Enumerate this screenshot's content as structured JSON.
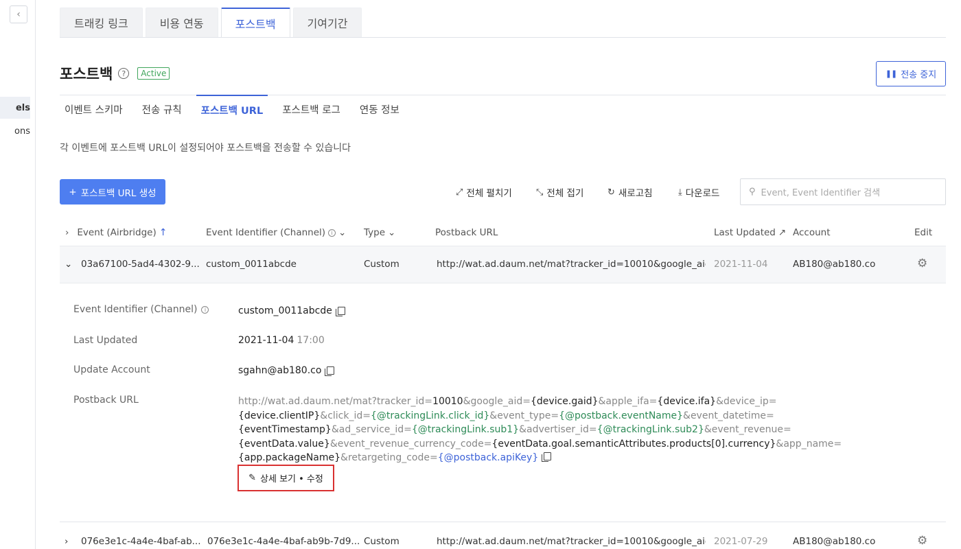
{
  "sidebar": {
    "collapse_icon": "chevron-left-icon",
    "items": [
      {
        "label": "els",
        "active": true
      },
      {
        "label": "ons",
        "active": false
      }
    ]
  },
  "top_tabs": [
    {
      "label": "트래킹 링크",
      "active": false
    },
    {
      "label": "비용 연동",
      "active": false
    },
    {
      "label": "포스트백",
      "active": true
    },
    {
      "label": "기여기간",
      "active": false
    }
  ],
  "header": {
    "title": "포스트백",
    "help_icon": "?",
    "status": "Active",
    "stop_button": "전송 중지"
  },
  "sub_tabs": [
    {
      "label": "이벤트 스키마",
      "active": false
    },
    {
      "label": "전송 규칙",
      "active": false
    },
    {
      "label": "포스트백 URL",
      "active": true
    },
    {
      "label": "포스트백 로그",
      "active": false
    },
    {
      "label": "연동 정보",
      "active": false
    }
  ],
  "description": "각 이벤트에 포스트백 URL이 설정되어야 포스트백을 전송할 수 있습니다",
  "toolbar": {
    "create_label": "포스트백 URL 생성",
    "expand_all": "전체 펼치기",
    "collapse_all": "전체 접기",
    "refresh": "새로고침",
    "download": "다운로드",
    "search_placeholder": "Event, Event Identifier 검색"
  },
  "table": {
    "headers": {
      "event": "Event (Airbridge)",
      "identifier": "Event Identifier (Channel)",
      "type": "Type",
      "postback_url": "Postback URL",
      "last_updated": "Last Updated",
      "account": "Account",
      "edit": "Edit"
    },
    "rows": [
      {
        "event": "03a67100-5ad4-4302-9...",
        "identifier": "custom_0011abcde",
        "type": "Custom",
        "url": "http://wat.ad.daum.net/mat?tracker_id=10010&google_aid=...",
        "updated": "2021-11-04",
        "account": "AB180@ab180.co",
        "expanded": true
      },
      {
        "event": "076e3e1c-4a4e-4baf-ab...",
        "identifier": "076e3e1c-4a4e-4baf-ab9b-7d9...",
        "type": "Custom",
        "url": "http://wat.ad.daum.net/mat?tracker_id=10010&google_aid=...",
        "updated": "2021-07-29",
        "account": "AB180@ab180.co",
        "expanded": false
      }
    ]
  },
  "detail": {
    "identifier_label": "Event Identifier (Channel)",
    "identifier_value": "custom_0011abcde",
    "updated_label": "Last Updated",
    "updated_date": "2021-11-04",
    "updated_time": "17:00",
    "account_label": "Update Account",
    "account_value": "sgahn@ab180.co",
    "url_label": "Postback URL",
    "url_parts": [
      {
        "t": "http://wat.ad.daum.net/mat?tracker_id=",
        "c": "m"
      },
      {
        "t": "10010",
        "c": "v"
      },
      {
        "t": "&google_aid=",
        "c": "m"
      },
      {
        "t": "{device.gaid}",
        "c": "v"
      },
      {
        "t": "&apple_ifa=",
        "c": "m"
      },
      {
        "t": "{device.ifa}",
        "c": "v"
      },
      {
        "t": "&device_ip=",
        "c": "m"
      },
      {
        "t": "{device.clientIP}",
        "c": "v"
      },
      {
        "t": "&click_id=",
        "c": "m"
      },
      {
        "t": "{@trackingLink.click_id}",
        "c": "g"
      },
      {
        "t": "&event_type=",
        "c": "m"
      },
      {
        "t": "{@postback.eventName}",
        "c": "g"
      },
      {
        "t": "&event_datetime=",
        "c": "m"
      },
      {
        "t": "{eventTimestamp}",
        "c": "v"
      },
      {
        "t": "&ad_service_id=",
        "c": "m"
      },
      {
        "t": "{@trackingLink.sub1}",
        "c": "g"
      },
      {
        "t": "&advertiser_id=",
        "c": "m"
      },
      {
        "t": "{@trackingLink.sub2}",
        "c": "g"
      },
      {
        "t": "&event_revenue=",
        "c": "m"
      },
      {
        "t": "{eventData.value}",
        "c": "v"
      },
      {
        "t": "&event_revenue_currency_code=",
        "c": "m"
      },
      {
        "t": "{eventData.goal.semanticAttributes.products[0].currency}",
        "c": "v"
      },
      {
        "t": "&app_name=",
        "c": "m"
      },
      {
        "t": "{app.packageName}",
        "c": "v"
      },
      {
        "t": "&retargeting_code=",
        "c": "m"
      },
      {
        "t": "{@postback.apiKey}",
        "c": "b"
      }
    ],
    "edit_button": "상세 보기 • 수정"
  },
  "colors": {
    "accent": "#3d63d8",
    "primary_button": "#4e7ef0",
    "active_badge": "#3fa55b",
    "variable_green": "#2e8b57",
    "highlight_border": "#d93030"
  }
}
